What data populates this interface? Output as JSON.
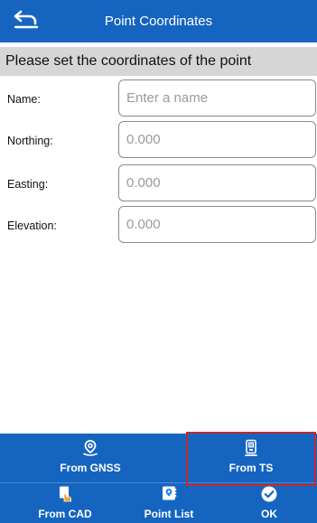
{
  "header": {
    "title": "Point Coordinates",
    "back_icon": "back-arrow-icon"
  },
  "subheader": {
    "text": "Please set the coordinates of the point"
  },
  "form": {
    "name": {
      "label": "Name:",
      "value": "",
      "placeholder": "Enter a name"
    },
    "northing": {
      "label": "Northing:",
      "value": "",
      "placeholder": "0.000"
    },
    "easting": {
      "label": "Easting:",
      "value": "",
      "placeholder": "0.000"
    },
    "elevation": {
      "label": "Elevation:",
      "value": "",
      "placeholder": "0.000"
    }
  },
  "toolbar": {
    "from_gnss": {
      "label": "From GNSS",
      "icon": "location-pin-icon"
    },
    "from_ts": {
      "label": "From TS",
      "icon": "total-station-icon"
    },
    "from_cad": {
      "label": "From CAD",
      "icon": "cad-hand-icon"
    },
    "point_list": {
      "label": "Point List",
      "icon": "map-pin-list-icon"
    },
    "ok": {
      "label": "OK",
      "icon": "checkmark-icon"
    }
  },
  "colors": {
    "primary": "#1565c0",
    "subheader_bg": "#d6d6d6",
    "highlight": "#c62828"
  }
}
